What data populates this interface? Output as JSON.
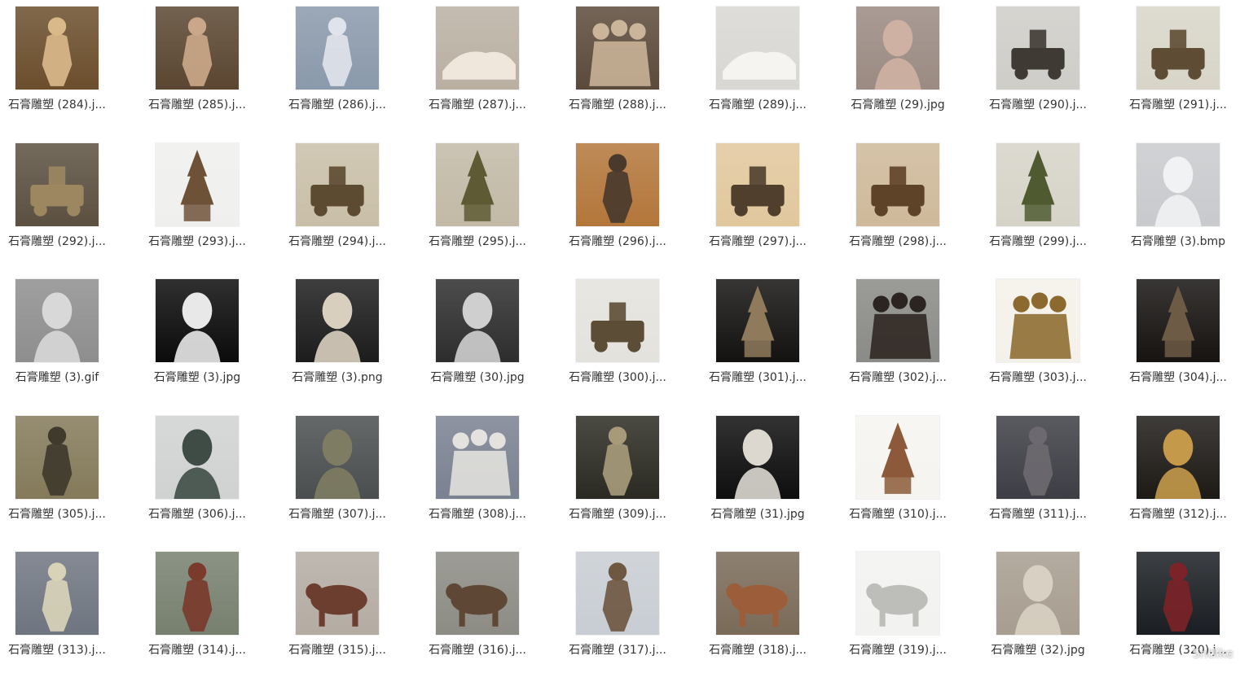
{
  "files": [
    {
      "name": "石膏雕塑 (284).j...",
      "bg": "#6b4e2c",
      "fg": "#d9b88a",
      "shape": "figure"
    },
    {
      "name": "石膏雕塑 (285).j...",
      "bg": "#5a4631",
      "fg": "#caa788",
      "shape": "figure"
    },
    {
      "name": "石膏雕塑 (286).j...",
      "bg": "#8a99ab",
      "fg": "#dfe3ea",
      "shape": "figure"
    },
    {
      "name": "石膏雕塑 (287).j...",
      "bg": "#b9b0a2",
      "fg": "#efe7dc",
      "shape": "recline"
    },
    {
      "name": "石膏雕塑 (288).j...",
      "bg": "#5b4a3a",
      "fg": "#cbb59a",
      "shape": "group"
    },
    {
      "name": "石膏雕塑 (289).j...",
      "bg": "#d9d7d3",
      "fg": "#f5f4f1",
      "shape": "recline"
    },
    {
      "name": "石膏雕塑 (29).jpg",
      "bg": "#9a8a82",
      "fg": "#cfb1a3",
      "shape": "bust"
    },
    {
      "name": "石膏雕塑 (290).j...",
      "bg": "#cfcdc8",
      "fg": "#3f3a33",
      "shape": "machine"
    },
    {
      "name": "石膏雕塑 (291).j...",
      "bg": "#d8d5c8",
      "fg": "#5e4d34",
      "shape": "machine"
    },
    {
      "name": "石膏雕塑 (292).j...",
      "bg": "#5b5040",
      "fg": "#9c8761",
      "shape": "machine"
    },
    {
      "name": "石膏雕塑 (293).j...",
      "bg": "#efefed",
      "fg": "#6e5238",
      "shape": "tower"
    },
    {
      "name": "石膏雕塑 (294).j...",
      "bg": "#c9bfa8",
      "fg": "#5c4a31",
      "shape": "machine"
    },
    {
      "name": "石膏雕塑 (295).j...",
      "bg": "#c2b9a6",
      "fg": "#5e5a33",
      "shape": "tower"
    },
    {
      "name": "石膏雕塑 (296).j...",
      "bg": "#b3763a",
      "fg": "#4a3a2c",
      "shape": "figure"
    },
    {
      "name": "石膏雕塑 (297).j...",
      "bg": "#e1c79c",
      "fg": "#4f3f2c",
      "shape": "machine"
    },
    {
      "name": "石膏雕塑 (298).j...",
      "bg": "#ceb99a",
      "fg": "#5e4329",
      "shape": "machine"
    },
    {
      "name": "石膏雕塑 (299).j...",
      "bg": "#d6d3c8",
      "fg": "#4f5a30",
      "shape": "tower"
    },
    {
      "name": "石膏雕塑 (3).bmp",
      "bg": "#c8cacd",
      "fg": "#f1f2f3",
      "shape": "bust"
    },
    {
      "name": "石膏雕塑 (3).gif",
      "bg": "#8e8e8e",
      "fg": "#d8d8d8",
      "shape": "bust"
    },
    {
      "name": "石膏雕塑 (3).jpg",
      "bg": "#0b0b0b",
      "fg": "#e8e8e8",
      "shape": "bust"
    },
    {
      "name": "石膏雕塑 (3).png",
      "bg": "#1c1c1c",
      "fg": "#d9cfbf",
      "shape": "bust"
    },
    {
      "name": "石膏雕塑 (30).jpg",
      "bg": "#2d2d2d",
      "fg": "#cfcfcf",
      "shape": "bust"
    },
    {
      "name": "石膏雕塑 (300).j...",
      "bg": "#e4e2dc",
      "fg": "#5c4d36",
      "shape": "machine"
    },
    {
      "name": "石膏雕塑 (301).j...",
      "bg": "#141210",
      "fg": "#8f7a5c",
      "shape": "tower"
    },
    {
      "name": "石膏雕塑 (302).j...",
      "bg": "#8a8a86",
      "fg": "#2c2420",
      "shape": "group"
    },
    {
      "name": "石膏雕塑 (303).j...",
      "bg": "#f4f1ea",
      "fg": "#8c6a2f",
      "shape": "group"
    },
    {
      "name": "石膏雕塑 (304).j...",
      "bg": "#161311",
      "fg": "#6e5b45",
      "shape": "tower"
    },
    {
      "name": "石膏雕塑 (305).j...",
      "bg": "#847a5a",
      "fg": "#3f3a2c",
      "shape": "figure"
    },
    {
      "name": "石膏雕塑 (306).j...",
      "bg": "#d0d2d2",
      "fg": "#3f4c46",
      "shape": "bust"
    },
    {
      "name": "石膏雕塑 (307).j...",
      "bg": "#4a4e4f",
      "fg": "#7e7c62",
      "shape": "bust"
    },
    {
      "name": "石膏雕塑 (308).j...",
      "bg": "#7a8190",
      "fg": "#e4e2de",
      "shape": "group"
    },
    {
      "name": "石膏雕塑 (309).j...",
      "bg": "#2b2a22",
      "fg": "#a69a7a",
      "shape": "figure"
    },
    {
      "name": "石膏雕塑 (31).jpg",
      "bg": "#0e0e0e",
      "fg": "#dcd8d0",
      "shape": "bust"
    },
    {
      "name": "石膏雕塑 (310).j...",
      "bg": "#f6f4f0",
      "fg": "#8c5a3a",
      "shape": "tower"
    },
    {
      "name": "石膏雕塑 (311).j...",
      "bg": "#3d3d45",
      "fg": "#6c6a70",
      "shape": "figure"
    },
    {
      "name": "石膏雕塑 (312).j...",
      "bg": "#1d1a16",
      "fg": "#c49a4a",
      "shape": "bust"
    },
    {
      "name": "石膏雕塑 (313).j...",
      "bg": "#6f7580",
      "fg": "#d8d2b8",
      "shape": "figure"
    },
    {
      "name": "石膏雕塑 (314).j...",
      "bg": "#77806f",
      "fg": "#7a3b2c",
      "shape": "figure"
    },
    {
      "name": "石膏雕塑 (315).j...",
      "bg": "#b4aca3",
      "fg": "#6b3e2f",
      "shape": "beast"
    },
    {
      "name": "石膏雕塑 (316).j...",
      "bg": "#8c8b84",
      "fg": "#5e4735",
      "shape": "beast"
    },
    {
      "name": "石膏雕塑 (317).j...",
      "bg": "#c8cdd3",
      "fg": "#6f5842",
      "shape": "figure"
    },
    {
      "name": "石膏雕塑 (318).j...",
      "bg": "#7a6a58",
      "fg": "#9c5e3a",
      "shape": "beast"
    },
    {
      "name": "石膏雕塑 (319).j...",
      "bg": "#f2f2f0",
      "fg": "#bdbdb9",
      "shape": "beast"
    },
    {
      "name": "石膏雕塑 (32).jpg",
      "bg": "#a79d90",
      "fg": "#d8d0c2",
      "shape": "bust"
    },
    {
      "name": "石膏雕塑 (320).j...",
      "bg": "#1a1e22",
      "fg": "#7b2328",
      "shape": "figure"
    }
  ],
  "watermark": "Sntlike"
}
